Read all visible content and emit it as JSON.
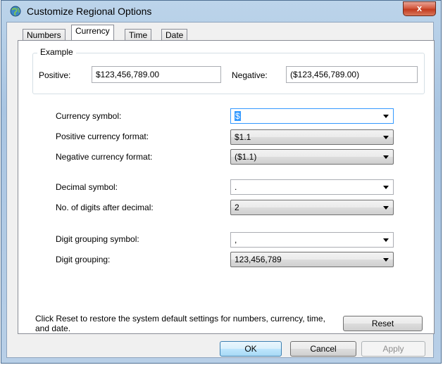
{
  "window": {
    "title": "Customize Regional Options",
    "close_label": "x"
  },
  "tabs": [
    {
      "label": "Numbers",
      "active": false
    },
    {
      "label": "Currency",
      "active": true
    },
    {
      "label": "Time",
      "active": false
    },
    {
      "label": "Date",
      "active": false
    }
  ],
  "example": {
    "legend": "Example",
    "positive_label": "Positive:",
    "positive_value": "$123,456,789.00",
    "negative_label": "Negative:",
    "negative_value": "($123,456,789.00)"
  },
  "settings": {
    "currency_symbol": {
      "label": "Currency symbol:",
      "value": "$"
    },
    "positive_format": {
      "label": "Positive currency format:",
      "value": "$1.1"
    },
    "negative_format": {
      "label": "Negative currency format:",
      "value": "($1.1)"
    },
    "decimal_symbol": {
      "label": "Decimal symbol:",
      "value": "."
    },
    "digits_after_decimal": {
      "label": "No. of digits after decimal:",
      "value": "2"
    },
    "grouping_symbol": {
      "label": "Digit grouping symbol:",
      "value": ","
    },
    "digit_grouping": {
      "label": "Digit grouping:",
      "value": "123,456,789"
    }
  },
  "reset": {
    "note": "Click Reset to restore the system default settings for numbers, currency, time, and date.",
    "button_label": "Reset"
  },
  "footer": {
    "ok_label": "OK",
    "cancel_label": "Cancel",
    "apply_label": "Apply"
  },
  "icons": {
    "title_icon": "globe-icon",
    "dropdown_icon": "chevron-down-icon"
  }
}
